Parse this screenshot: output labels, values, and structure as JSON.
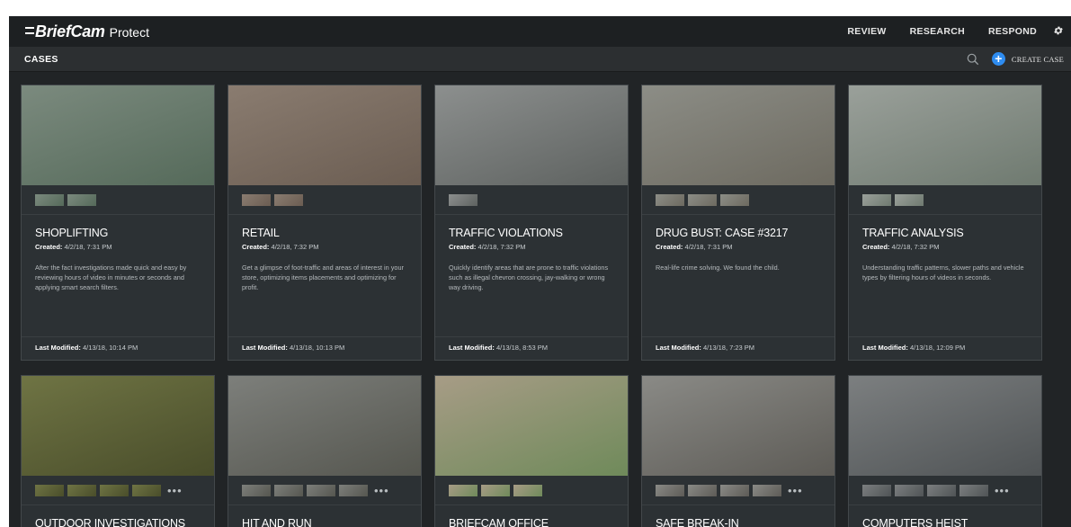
{
  "app": {
    "brand": "BriefCam",
    "product": "Protect"
  },
  "nav": [
    {
      "label": "REVIEW"
    },
    {
      "label": "RESEARCH"
    },
    {
      "label": "RESPOND"
    }
  ],
  "subbar": {
    "title": "CASES",
    "create_label": "CREATE CASE"
  },
  "labels": {
    "created": "Created:",
    "last_modified": "Last Modified:"
  },
  "cases": [
    {
      "title": "SHOPLIFTING",
      "created": "4/2/18, 7:31 PM",
      "description": "After the fact investigations made quick and easy by reviewing hours of video in minutes or seconds and applying smart search filters.",
      "last_modified": "4/13/18, 10:14 PM",
      "thumb_colors": [
        "#7b8a7e",
        "#556a5a"
      ],
      "mini_count": 2
    },
    {
      "title": "RETAIL",
      "created": "4/2/18, 7:32 PM",
      "description": "Get a glimpse of foot-traffic and areas of interest in your store, optimizing items placements and optimizing for profit.",
      "last_modified": "4/13/18, 10:13 PM",
      "thumb_colors": [
        "#8a7c70",
        "#6b5d52"
      ],
      "mini_count": 2
    },
    {
      "title": "TRAFFIC VIOLATIONS",
      "created": "4/2/18, 7:32 PM",
      "description": "Quickly identify areas that are prone to traffic violations such as illegal chevron crossing, jay-walking or wrong way driving.",
      "last_modified": "4/13/18, 8:53 PM",
      "thumb_colors": [
        "#8c8f8e",
        "#5e6260"
      ],
      "mini_count": 1
    },
    {
      "title": "DRUG BUST: CASE #3217",
      "created": "4/2/18, 7:31 PM",
      "description": "Real-life crime solving. We found the child.",
      "last_modified": "4/13/18, 7:23 PM",
      "thumb_colors": [
        "#8c8d86",
        "#6d6a60"
      ],
      "mini_count": 3
    },
    {
      "title": "TRAFFIC ANALYSIS",
      "created": "4/2/18, 7:32 PM",
      "description": "Understanding traffic patterns, slower paths and vehicle types by filtering hours of videos in seconds.",
      "last_modified": "4/13/18, 12:09 PM",
      "thumb_colors": [
        "#9aa09a",
        "#6f7a70"
      ],
      "mini_count": 2
    },
    {
      "title": "OUTDOOR INVESTIGATIONS",
      "thumb_colors": [
        "#6f7444",
        "#494d2a"
      ],
      "mini_count": 4,
      "more": "•••"
    },
    {
      "title": "HIT AND RUN",
      "thumb_colors": [
        "#7d7f7b",
        "#55564f"
      ],
      "mini_count": 4,
      "more": "•••"
    },
    {
      "title": "BRIEFCAM OFFICE",
      "thumb_colors": [
        "#a79c86",
        "#6f8a5a"
      ],
      "mini_count": 3
    },
    {
      "title": "SAFE BREAK-IN",
      "thumb_colors": [
        "#8a8a86",
        "#5d5b56"
      ],
      "mini_count": 4,
      "more": "•••"
    },
    {
      "title": "COMPUTERS HEIST",
      "thumb_colors": [
        "#7c7f80",
        "#4f5355"
      ],
      "mini_count": 4,
      "more": "•••"
    }
  ]
}
